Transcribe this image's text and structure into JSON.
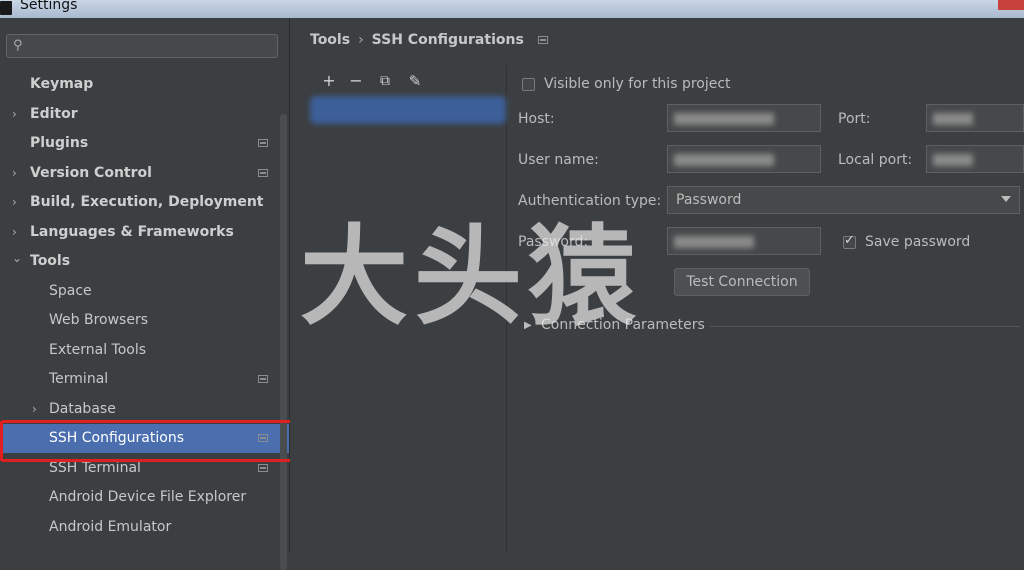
{
  "window": {
    "title": "Settings"
  },
  "search": {
    "placeholder": ""
  },
  "sidebar": {
    "items": [
      {
        "label": "Keymap",
        "level": 0,
        "bold": true
      },
      {
        "label": "Editor",
        "level": 0,
        "bold": true,
        "arrow": "›"
      },
      {
        "label": "Plugins",
        "level": 0,
        "bold": true
      },
      {
        "label": "Version Control",
        "level": 0,
        "bold": true,
        "arrow": "›"
      },
      {
        "label": "Build, Execution, Deployment",
        "level": 0,
        "bold": true,
        "arrow": "›"
      },
      {
        "label": "Languages & Frameworks",
        "level": 0,
        "bold": true,
        "arrow": "›"
      },
      {
        "label": "Tools",
        "level": 0,
        "bold": true,
        "arrow": "⌄"
      },
      {
        "label": "Space",
        "level": 1
      },
      {
        "label": "Web Browsers",
        "level": 1
      },
      {
        "label": "External Tools",
        "level": 1
      },
      {
        "label": "Terminal",
        "level": 1
      },
      {
        "label": "Database",
        "level": 1,
        "arrow": "›"
      },
      {
        "label": "SSH Configurations",
        "level": 1,
        "selected": true
      },
      {
        "label": "SSH Terminal",
        "level": 1
      },
      {
        "label": "Android Device File Explorer",
        "level": 1
      },
      {
        "label": "Android Emulator",
        "level": 1
      }
    ]
  },
  "breadcrumb": {
    "parent": "Tools",
    "separator": "›",
    "current": "SSH Configurations"
  },
  "toolbar": {
    "add": "+",
    "remove": "−",
    "copy": "⧉",
    "edit": "✎"
  },
  "form": {
    "visible_only_label": "Visible only for this project",
    "host_label": "Host:",
    "port_label": "Port:",
    "username_label": "User name:",
    "local_port_label": "Local port:",
    "auth_type_label": "Authentication type:",
    "auth_type_value": "Password",
    "password_label": "Password:",
    "save_password_label": "Save password",
    "test_connection_label": "Test Connection",
    "connection_params_label": "Connection Parameters"
  },
  "watermark": {
    "text": "大头猿"
  },
  "colors": {
    "selection": "#4b6eaf",
    "highlight_box": "#e02020",
    "background": "#3c3f41"
  }
}
